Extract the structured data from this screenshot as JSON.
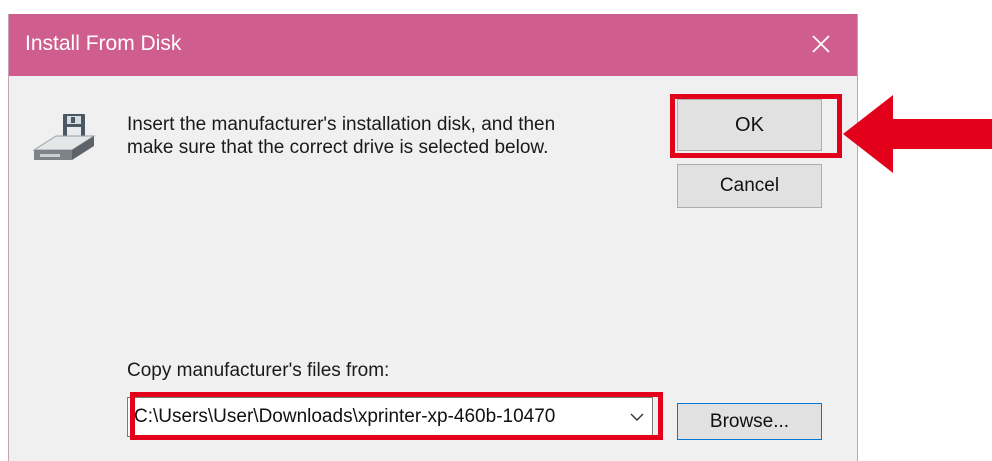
{
  "window": {
    "title": "Install From Disk",
    "close_icon": "close-icon"
  },
  "icon": {
    "name": "floppy-drive-icon"
  },
  "message": {
    "line1": "Insert the manufacturer's installation disk, and then",
    "line2": "make sure that the correct drive is selected below."
  },
  "buttons": {
    "ok_label": "OK",
    "cancel_label": "Cancel",
    "browse_label": "Browse..."
  },
  "copy_from": {
    "label": "Copy manufacturer's files from:",
    "value": "C:\\Users\\User\\Downloads\\xprinter-xp-460b-10470"
  },
  "colors": {
    "titlebar": "#cf5d8e",
    "highlight": "#e3001b",
    "dialog_background": "#f0f0f0",
    "focus_border": "#0078d7"
  }
}
